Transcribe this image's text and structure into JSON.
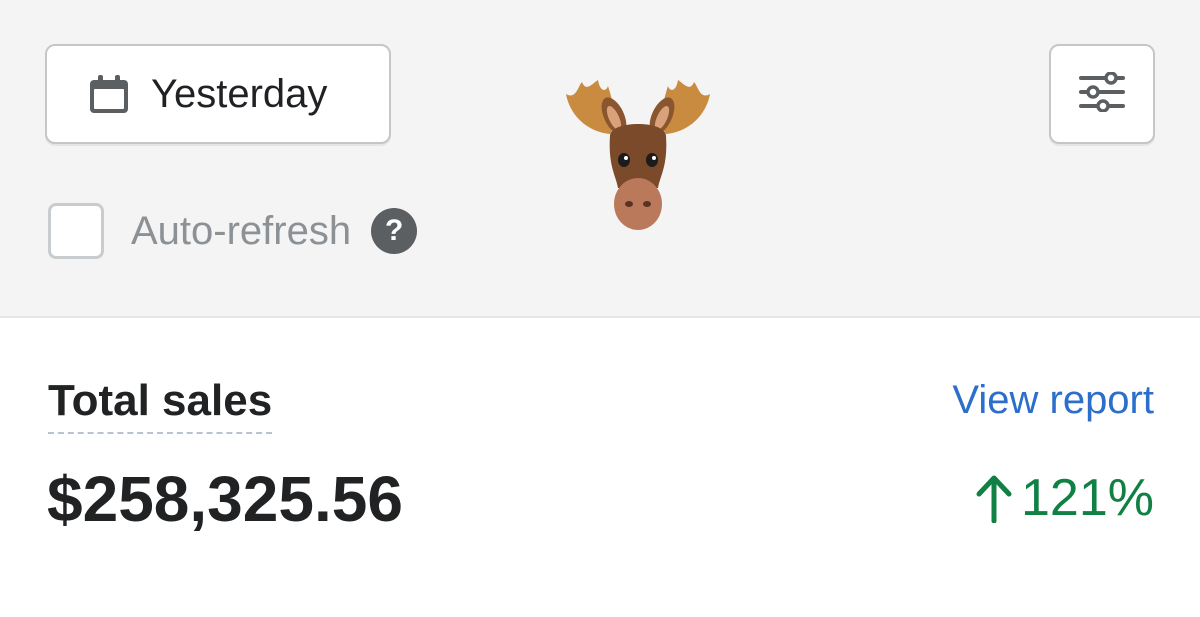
{
  "header": {
    "date_button_label": "Yesterday",
    "date_icon": "calendar-icon",
    "filter_icon": "sliders-icon",
    "auto_refresh_label": "Auto-refresh",
    "auto_refresh_checked": false,
    "help_icon_glyph": "?",
    "sticker": "moose-emoji"
  },
  "sales": {
    "title": "Total sales",
    "view_report_label": "View report",
    "amount": "$258,325.56",
    "change": "121%",
    "change_direction": "up"
  },
  "colors": {
    "panel_bg": "#f4f4f4",
    "link": "#2c6ecb",
    "positive": "#108043",
    "text": "#202223"
  }
}
